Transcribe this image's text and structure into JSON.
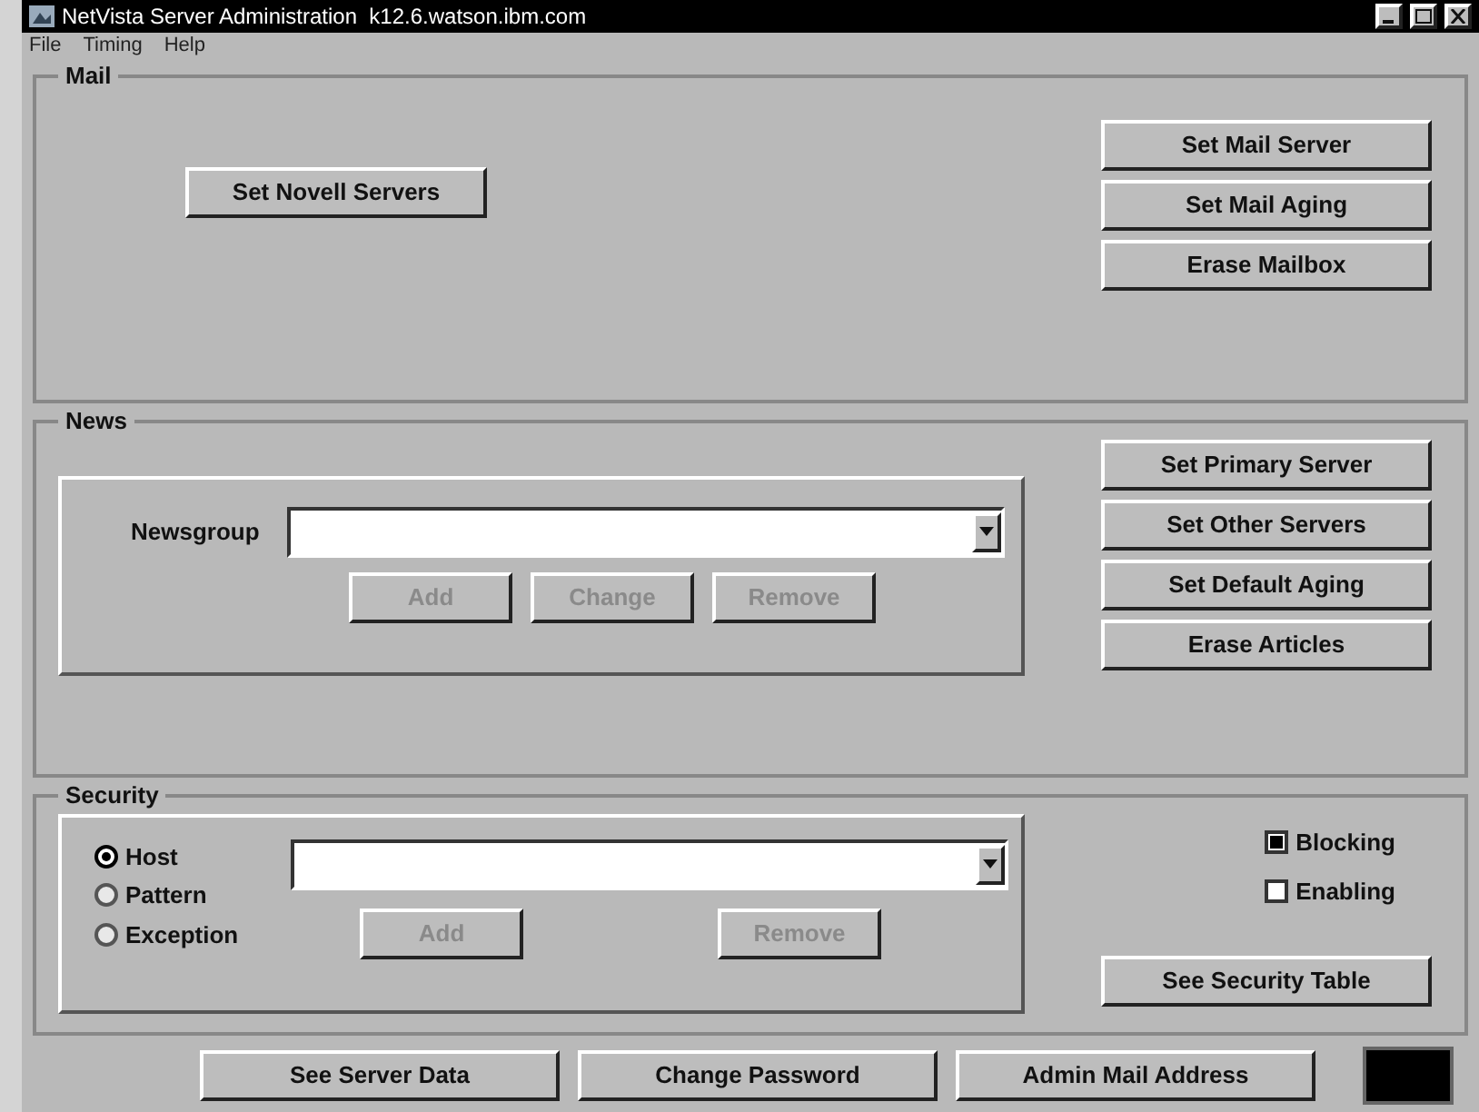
{
  "window": {
    "title": "NetVista Server Administration  k12.6.watson.ibm.com"
  },
  "menu": [
    "File",
    "Timing",
    "Help"
  ],
  "mail": {
    "title": "Mail",
    "left_buttons": [
      "Set Novell Servers"
    ],
    "buttons": [
      "Set Mail Server",
      "Set Mail Aging",
      "Erase Mailbox"
    ]
  },
  "news": {
    "title": "News",
    "field_label": "Newsgroup",
    "actions": [
      {
        "label": "Add",
        "disabled": true
      },
      {
        "label": "Change",
        "disabled": true
      },
      {
        "label": "Remove",
        "disabled": true
      }
    ],
    "buttons": [
      "Set Primary Server",
      "Set Other Servers",
      "Set Default Aging",
      "Erase Articles"
    ]
  },
  "security": {
    "title": "Security",
    "radios": [
      {
        "label": "Host",
        "selected": true
      },
      {
        "label": "Pattern",
        "selected": false
      },
      {
        "label": "Exception",
        "selected": false
      }
    ],
    "actions": [
      {
        "label": "Add",
        "disabled": true
      },
      {
        "label": "Remove",
        "disabled": true
      }
    ],
    "checkboxes": [
      {
        "label": "Blocking",
        "checked": true
      },
      {
        "label": "Enabling",
        "checked": false
      }
    ],
    "table_button": "See Security Table"
  },
  "footer_buttons": [
    "See Server Data",
    "Change Password",
    "Admin Mail Address"
  ]
}
